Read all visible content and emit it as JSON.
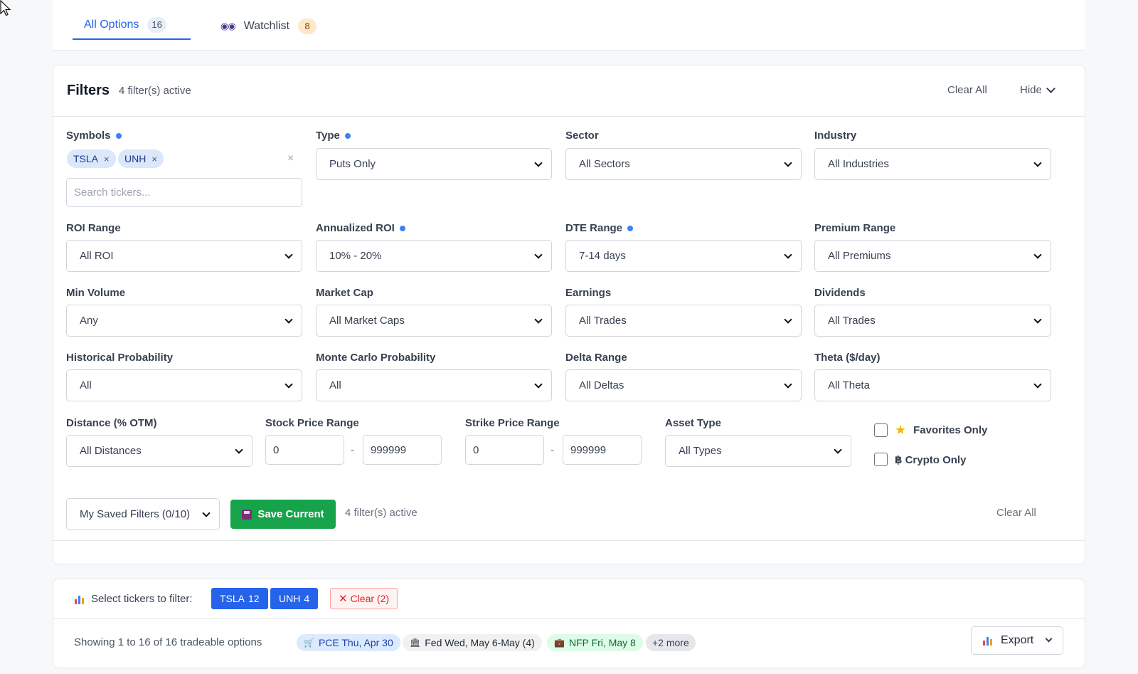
{
  "tabs": {
    "all_options": {
      "label": "All Options",
      "count": "16"
    },
    "watchlist": {
      "icon": "eyes-icon",
      "label": "Watchlist",
      "count": "8"
    }
  },
  "filters": {
    "title": "Filters",
    "active_text": "4 filter(s) active",
    "clear_all": "Clear All",
    "hide": "Hide",
    "symbols": {
      "label": "Symbols",
      "chips": [
        "TSLA",
        "UNH"
      ],
      "chip_remove": "×",
      "clear_symbol": "×",
      "search_placeholder": "Search tickers..."
    },
    "type": {
      "label": "Type",
      "value": "Puts Only"
    },
    "sector": {
      "label": "Sector",
      "value": "All Sectors"
    },
    "industry": {
      "label": "Industry",
      "value": "All Industries"
    },
    "roi_range": {
      "label": "ROI Range",
      "value": "All ROI"
    },
    "annualized_roi": {
      "label": "Annualized ROI",
      "value": "10% - 20%"
    },
    "dte_range": {
      "label": "DTE Range",
      "value": "7-14 days"
    },
    "premium_range": {
      "label": "Premium Range",
      "value": "All Premiums"
    },
    "min_volume": {
      "label": "Min Volume",
      "value": "Any"
    },
    "market_cap": {
      "label": "Market Cap",
      "value": "All Market Caps"
    },
    "earnings": {
      "label": "Earnings",
      "value": "All Trades"
    },
    "dividends": {
      "label": "Dividends",
      "value": "All Trades"
    },
    "historical_probability": {
      "label": "Historical Probability",
      "value": "All"
    },
    "monte_carlo_probability": {
      "label": "Monte Carlo Probability",
      "value": "All"
    },
    "delta_range": {
      "label": "Delta Range",
      "value": "All Deltas"
    },
    "theta": {
      "label": "Theta ($/day)",
      "value": "All Theta"
    },
    "distance": {
      "label": "Distance (% OTM)",
      "value": "All Distances"
    },
    "stock_price_range": {
      "label": "Stock Price Range",
      "min": "0",
      "max": "999999",
      "separator": "-"
    },
    "strike_price_range": {
      "label": "Strike Price Range",
      "min": "0",
      "max": "999999",
      "separator": "-"
    },
    "asset_type": {
      "label": "Asset Type",
      "value": "All Types"
    },
    "favorites_only": {
      "label": "Favorites Only",
      "icon": "star-icon",
      "checked": false
    },
    "crypto_only": {
      "label": "฿ Crypto Only",
      "checked": false
    },
    "saved_filters": {
      "value": "My Saved Filters (0/10)"
    },
    "save_current": {
      "label": "Save Current",
      "icon": "floppy-disk-icon"
    },
    "bottom_active_text": "4 filter(s) active",
    "bottom_clear_all": "Clear All"
  },
  "ticker_select": {
    "label": "Select tickers to filter:",
    "tickers": [
      {
        "symbol": "TSLA",
        "count": "12"
      },
      {
        "symbol": "UNH",
        "count": "4"
      }
    ],
    "clear": "Clear (2)"
  },
  "results": {
    "showing": "Showing 1 to 16 of 16 tradeable options",
    "events": [
      {
        "icon": "cart-icon",
        "label": "PCE Thu, Apr 30"
      },
      {
        "icon": "bank-icon",
        "label": "Fed Wed, May 6-May (4)"
      },
      {
        "icon": "briefcase-icon",
        "label": "NFP Fri, May 8"
      }
    ],
    "more": "+2 more",
    "export": "Export"
  },
  "colors": {
    "accent": "#2563eb",
    "save_green": "#16a34a",
    "active_dot": "#3b82f6"
  }
}
